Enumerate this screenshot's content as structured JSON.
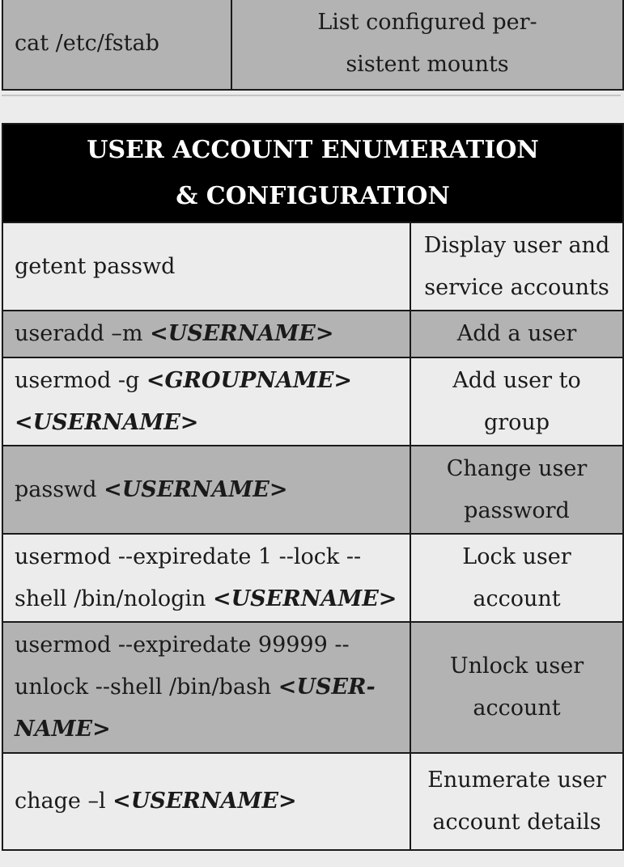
{
  "top_row": {
    "command": "cat /etc/fstab",
    "description": "List configured per-\nsistent mounts"
  },
  "section": {
    "title_line1": "USER ACCOUNT ENUMERATION",
    "title_line2": "& CONFIGURATION",
    "rows": [
      {
        "cmd1": "getent passwd",
        "desc": "Display user and service accounts"
      },
      {
        "cmd1": "useradd –m ",
        "arg1": "<USERNAME>",
        "desc": "Add a user"
      },
      {
        "cmd1": "usermod -g ",
        "arg1": "<GROUPNAME>",
        "arg2": "<USERNAME>",
        "desc": "Add user to group"
      },
      {
        "cmd1": "passwd ",
        "arg1": "<USERNAME>",
        "desc": "Change user password"
      },
      {
        "cmd1": "usermod --expiredate 1 --lock --",
        "cmd2": "shell /bin/nologin ",
        "arg1": "<USERNAME>",
        "desc": "Lock user account"
      },
      {
        "cmd1": "usermod --expiredate 99999 --",
        "cmd2": "unlock --shell /bin/bash ",
        "arg1": "<USER-",
        "arg2": "NAME>",
        "desc": "Unlock user account"
      },
      {
        "cmd1": "chage –l ",
        "arg1": "<USERNAME>",
        "desc": "Enumerate user account details"
      }
    ]
  }
}
